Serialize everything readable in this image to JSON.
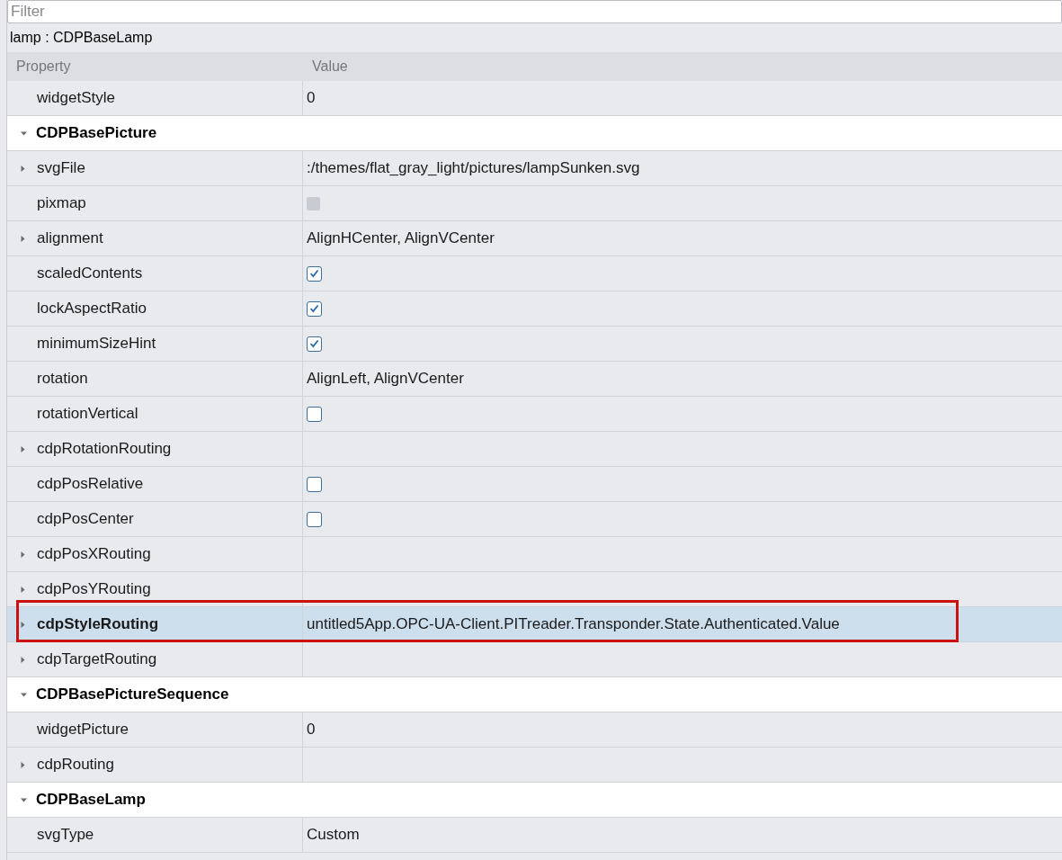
{
  "filter": {
    "placeholder": "Filter"
  },
  "object_label": "lamp : CDPBaseLamp",
  "columns": [
    "Property",
    "Value"
  ],
  "rows": [
    {
      "kind": "property",
      "name": "widgetStyle",
      "value": "0",
      "selected": false
    },
    {
      "kind": "group",
      "name": "CDPBasePicture",
      "expanded": true
    },
    {
      "kind": "property",
      "name": "svgFile",
      "expanded": false,
      "value": ":/themes/flat_gray_light/pictures/lampSunken.svg",
      "selected": false
    },
    {
      "kind": "property",
      "name": "pixmap",
      "checked": false,
      "disabled": true,
      "selected": false
    },
    {
      "kind": "property",
      "name": "alignment",
      "expanded": false,
      "value": "AlignHCenter, AlignVCenter",
      "selected": false
    },
    {
      "kind": "property",
      "name": "scaledContents",
      "checked": true,
      "disabled": false,
      "selected": false
    },
    {
      "kind": "property",
      "name": "lockAspectRatio",
      "checked": true,
      "disabled": false,
      "selected": false
    },
    {
      "kind": "property",
      "name": "minimumSizeHint",
      "checked": true,
      "disabled": false,
      "selected": false
    },
    {
      "kind": "property",
      "name": "rotation",
      "value": "AlignLeft, AlignVCenter",
      "selected": false
    },
    {
      "kind": "property",
      "name": "rotationVertical",
      "checked": false,
      "disabled": false,
      "selected": false
    },
    {
      "kind": "property",
      "name": "cdpRotationRouting",
      "expanded": false,
      "selected": false
    },
    {
      "kind": "property",
      "name": "cdpPosRelative",
      "checked": false,
      "disabled": false,
      "selected": false
    },
    {
      "kind": "property",
      "name": "cdpPosCenter",
      "checked": false,
      "disabled": false,
      "selected": false
    },
    {
      "kind": "property",
      "name": "cdpPosXRouting",
      "expanded": false,
      "selected": false
    },
    {
      "kind": "property",
      "name": "cdpPosYRouting",
      "expanded": false,
      "selected": false
    },
    {
      "kind": "property",
      "name": "cdpStyleRouting",
      "expanded": false,
      "value": "untitled5App.OPC-UA-Client.PITreader.Transponder.State.Authenticated.Value",
      "selected": true,
      "highlighted": true
    },
    {
      "kind": "property",
      "name": "cdpTargetRouting",
      "expanded": false,
      "selected": false
    },
    {
      "kind": "group",
      "name": "CDPBasePictureSequence",
      "expanded": true
    },
    {
      "kind": "property",
      "name": "widgetPicture",
      "value": "0",
      "selected": false
    },
    {
      "kind": "property",
      "name": "cdpRouting",
      "expanded": false,
      "selected": false
    },
    {
      "kind": "group",
      "name": "CDPBaseLamp",
      "expanded": true
    },
    {
      "kind": "property",
      "name": "svgType",
      "value": "Custom",
      "selected": false
    }
  ]
}
